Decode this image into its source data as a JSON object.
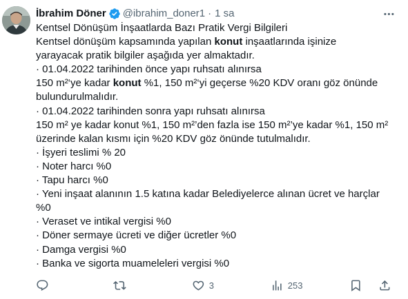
{
  "author": {
    "name": "İbrahim Döner",
    "handle": "@ibrahim_doner1",
    "separator": "·",
    "time": "1 sa"
  },
  "tweet": {
    "lines": [
      [
        {
          "t": "Kentsel Dönüşüm İnşaatlarda Bazı Pratik Vergi Bilgileri"
        }
      ],
      [
        {
          "t": "Kentsel dönüşüm kapsamında yapılan "
        },
        {
          "t": "konut",
          "b": true
        },
        {
          "t": " inşaatlarında işinize"
        }
      ],
      [
        {
          "t": "yarayacak pratik bilgiler aşağıda yer almaktadır."
        }
      ],
      [
        {
          "t": "· 01.04.2022 tarihinden önce yapı ruhsatı alınırsa"
        }
      ],
      [
        {
          "t": "150 m²‘ye kadar "
        },
        {
          "t": "konut",
          "b": true
        },
        {
          "t": " %1, 150 m²‘yi geçerse %20 KDV oranı göz önünde"
        }
      ],
      [
        {
          "t": "bulundurulmalıdır."
        }
      ],
      [
        {
          "t": "· 01.04.2022 tarihinden sonra yapı ruhsatı alınırsa"
        }
      ],
      [
        {
          "t": "150 m² ye kadar konut %1, 150 m²’den fazla ise 150 m²’ye kadar %1, 150 m²"
        }
      ],
      [
        {
          "t": "üzerinde kalan kısmı için %20 KDV göz önünde tutulmalıdır."
        }
      ],
      [
        {
          "t": "· İşyeri teslimi % 20"
        }
      ],
      [
        {
          "t": "· Noter harcı %0"
        }
      ],
      [
        {
          "t": "· Tapu harcı %0"
        }
      ],
      [
        {
          "t": "· Yeni inşaat alanının 1.5 katına kadar Belediyelerce alınan ücret ve harçlar"
        }
      ],
      [
        {
          "t": "%0"
        }
      ],
      [
        {
          "t": "· Veraset ve intikal vergisi %0"
        }
      ],
      [
        {
          "t": "· Döner sermaye ücreti ve diğer ücretler %0"
        }
      ],
      [
        {
          "t": "· Damga vergisi %0"
        }
      ],
      [
        {
          "t": "· Banka ve sigorta muameleleri vergisi %0"
        }
      ]
    ]
  },
  "actions": {
    "reply_count": "",
    "retweet_count": "",
    "like_count": "3",
    "views_count": "253"
  },
  "icons": {
    "verified": "verified-badge-icon",
    "more": "more-options-icon",
    "reply": "reply-icon",
    "retweet": "retweet-icon",
    "like": "like-icon",
    "views": "views-icon",
    "bookmark": "bookmark-icon",
    "share": "share-icon"
  },
  "colors": {
    "text": "#0f1419",
    "secondary": "#536471",
    "verified": "#1d9bf0"
  }
}
